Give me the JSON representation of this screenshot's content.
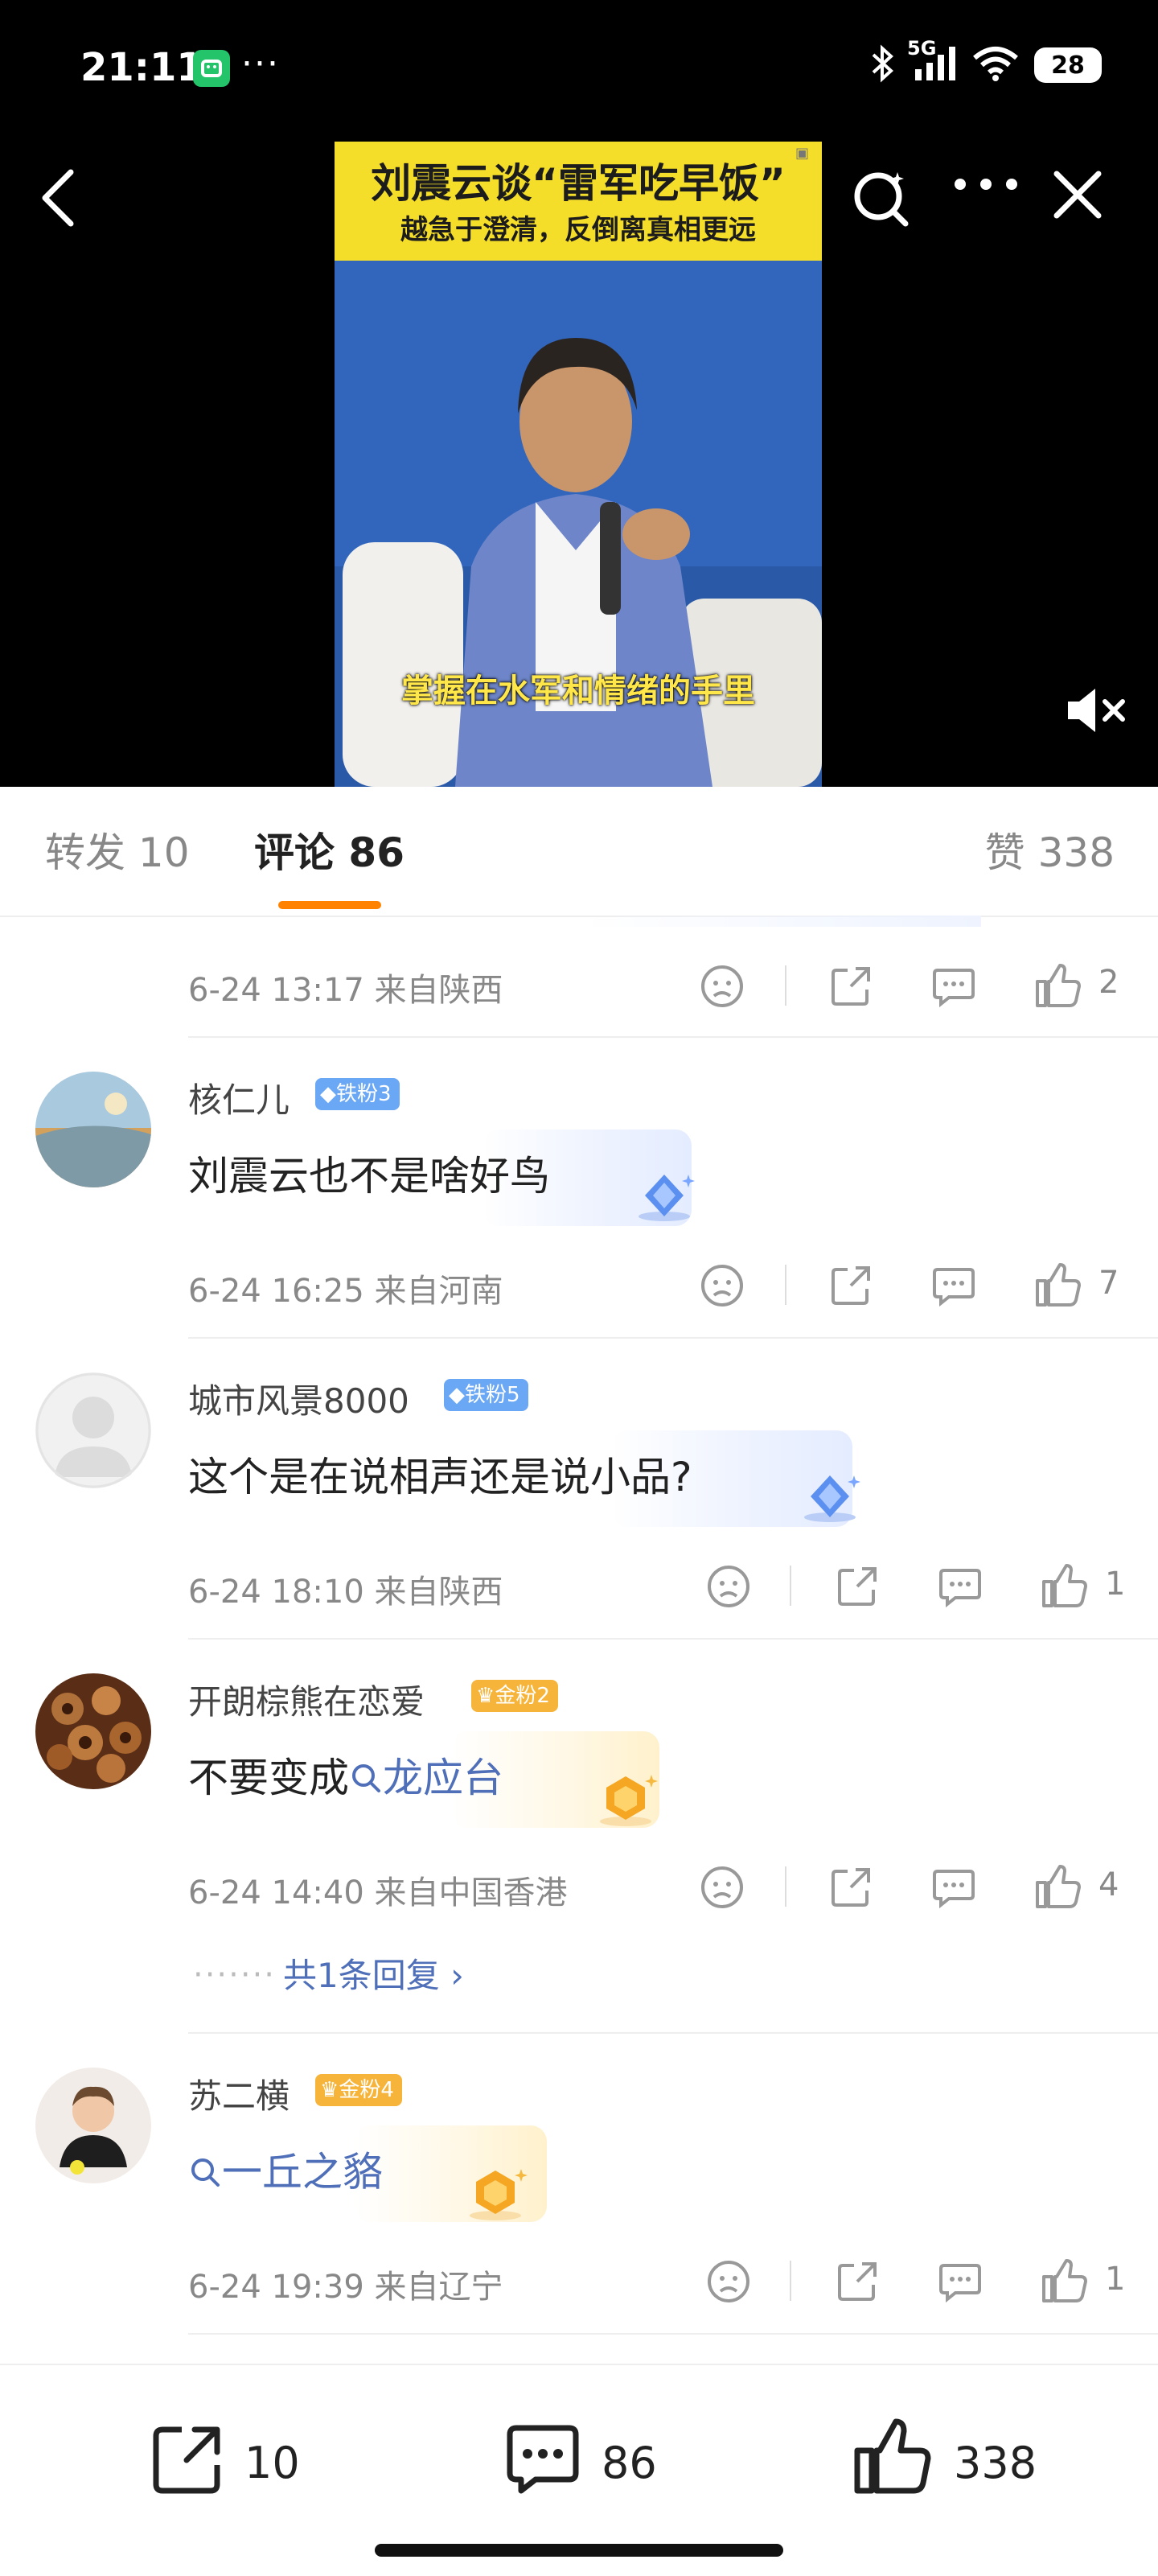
{
  "status_bar": {
    "time": "21:11",
    "dots": "···",
    "network": "5G",
    "battery": "28"
  },
  "video": {
    "title": "刘震云谈“雷军吃早饭”",
    "subtitle": "越急于澄清，反倒离真相更远",
    "caption": "掌握在水军和情绪的手里"
  },
  "tabs": {
    "repost": "转发 10",
    "comments": "评论 86",
    "likes": "赞 338"
  },
  "comments": [
    {
      "meta": "6-24 13:17  来自陕西",
      "like_count": "2"
    },
    {
      "username": "核仁儿",
      "badge": "铁粉3",
      "text": "刘震云也不是啥好鸟",
      "meta": "6-24 16:25  来自河南",
      "like_count": "7"
    },
    {
      "username": "城市风景8000",
      "badge": "铁粉5",
      "text": "这个是在说相声还是说小品?",
      "meta": "6-24 18:10  来自陕西",
      "like_count": "1"
    },
    {
      "username": "开朗棕熊在恋爱",
      "badge": "金粉2",
      "text_prefix": "不要变成",
      "topic": "龙应台",
      "meta": "6-24 14:40  来自中国香港",
      "like_count": "4",
      "reply_dots": "·······",
      "reply_link": "共1条回复 ›"
    },
    {
      "username": "苏二横",
      "badge": "金粉4",
      "topic": "一丘之貉",
      "meta": "6-24 19:39  来自辽宁",
      "like_count": "1"
    }
  ],
  "bottom_bar": {
    "repost_count": "10",
    "comment_count": "86",
    "like_count": "338"
  },
  "colors": {
    "accent": "#ff8200",
    "topic": "#4f6fb8",
    "iron_badge": "#6aa7f5",
    "gold_badge": "#f6b43a"
  }
}
